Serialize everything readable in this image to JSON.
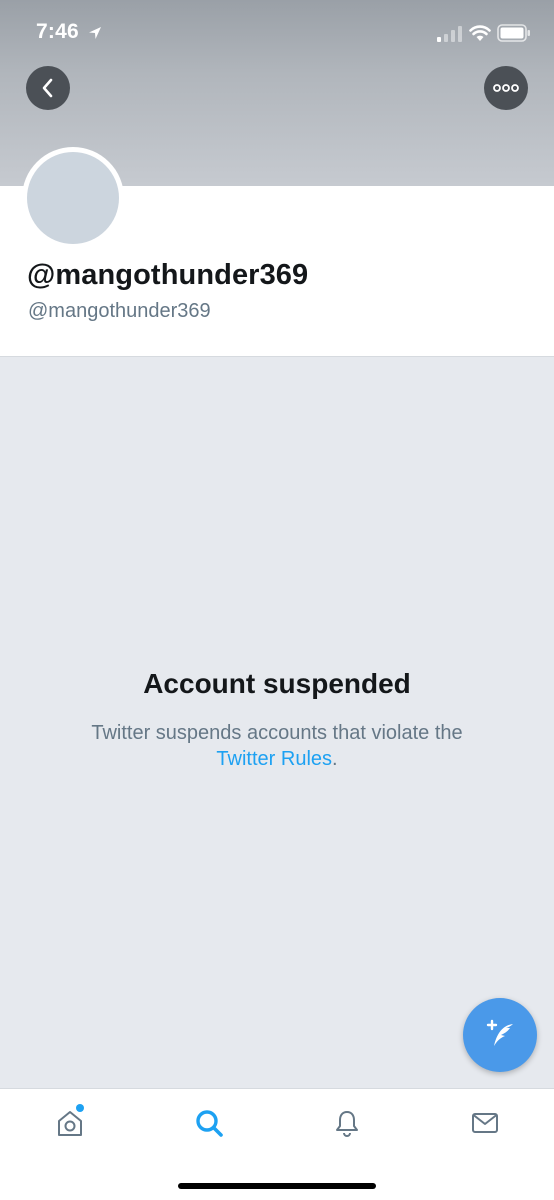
{
  "status_bar": {
    "time": "7:46"
  },
  "profile": {
    "display_name": "@mangothunder369",
    "handle": "@mangothunder369"
  },
  "notice": {
    "title": "Account suspended",
    "text_prefix": "Twitter suspends accounts that violate the",
    "link_text": "Twitter Rules",
    "text_suffix": "."
  },
  "tab_bar": {
    "items": [
      {
        "icon": "home-icon",
        "active": false,
        "has_badge_dot": true
      },
      {
        "icon": "search-icon",
        "active": true
      },
      {
        "icon": "bell-icon",
        "active": false
      },
      {
        "icon": "mail-icon",
        "active": false
      }
    ]
  },
  "colors": {
    "accent": "#1da1f2",
    "fab": "#4a99e9",
    "background": "#e6e9ee",
    "text_primary": "#14171a",
    "text_secondary": "#657786"
  }
}
